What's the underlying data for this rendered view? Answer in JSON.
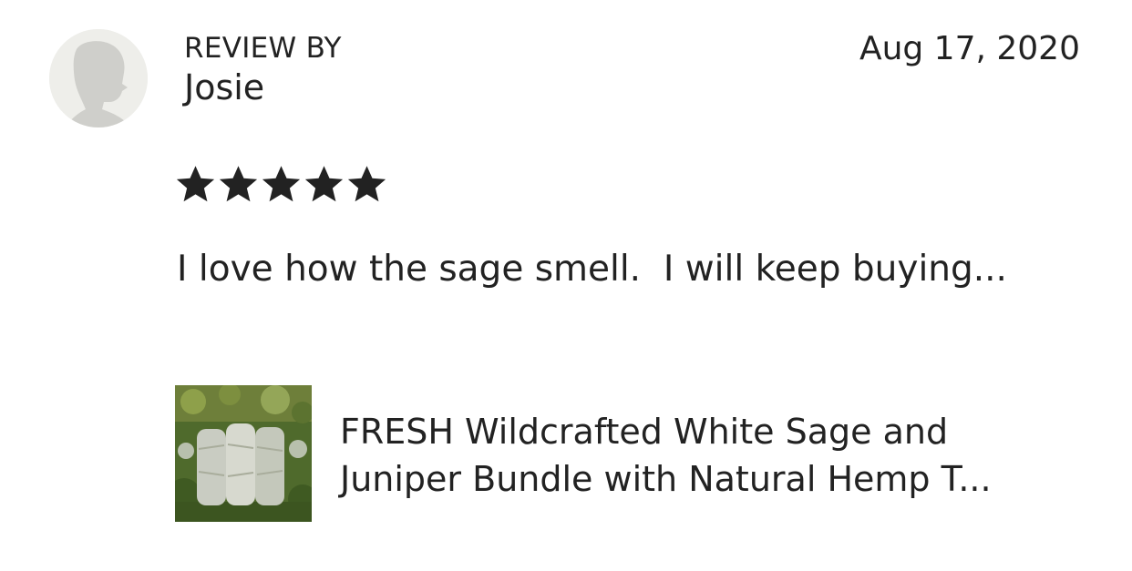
{
  "review": {
    "header_label": "REVIEW BY",
    "reviewer_name": "Josie",
    "date": "Aug 17, 2020",
    "rating": 5,
    "rating_max": 5,
    "text": "I love how the sage smell.  I will keep buying..."
  },
  "product": {
    "title_line1": "FRESH Wildcrafted White Sage and",
    "title_line2": "Juniper Bundle with Natural Hemp T..."
  },
  "icons": {
    "avatar": "default-user-silhouette-icon",
    "star": "star-filled-icon"
  },
  "colors": {
    "text": "#222222",
    "star": "#222222",
    "avatar_bg": "#eeeeea",
    "avatar_silhouette": "#cfcfcb"
  }
}
